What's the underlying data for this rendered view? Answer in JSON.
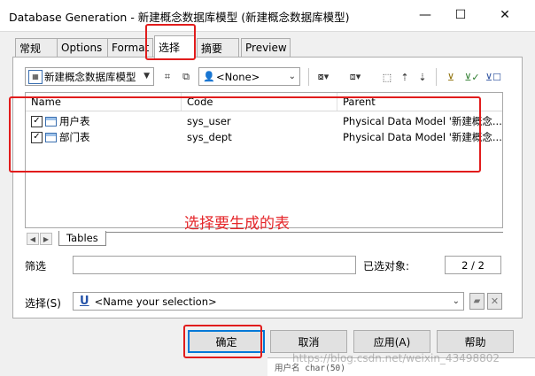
{
  "window": {
    "title": "Database Generation - 新建概念数据库模型 (新建概念数据库模型)",
    "minimize_glyph": "—",
    "maximize_glyph": "☐",
    "close_glyph": "✕"
  },
  "tabs": [
    {
      "label": "常规",
      "active": false
    },
    {
      "label": "Options",
      "active": false
    },
    {
      "label": "Format",
      "active": false
    },
    {
      "label": "选择",
      "active": true
    },
    {
      "label": "摘要",
      "active": false
    },
    {
      "label": "Preview",
      "active": false
    }
  ],
  "toolbar": {
    "model_combo": "新建概念数据库模型",
    "owner_combo": "<None>",
    "icons": [
      "tree-icon",
      "pick-icon",
      "user-icon",
      "select-all-icon",
      "deselect-all-icon",
      "move-up-icon",
      "move-down-icon",
      "filter-icon",
      "filter-selected-icon",
      "filter-clear-icon"
    ]
  },
  "list": {
    "columns": [
      "Name",
      "Code",
      "Parent"
    ],
    "rows": [
      {
        "checked": true,
        "name": "用户表",
        "code": "sys_user",
        "parent": "Physical Data Model '新建概念..."
      },
      {
        "checked": true,
        "name": "部门表",
        "code": "sys_dept",
        "parent": "Physical Data Model '新建概念..."
      }
    ]
  },
  "bottom_tab": "Tables",
  "annotation": "选择要生成的表",
  "filter": {
    "label": "筛选",
    "value": "",
    "selected_label": "已选对象:",
    "selected_count": "2 / 2"
  },
  "selection": {
    "label": "选择(S)",
    "placeholder": "<Name your selection>"
  },
  "buttons": {
    "ok": "确定",
    "cancel": "取消",
    "apply": "应用(A)",
    "help": "帮助"
  },
  "background": {
    "snippet": "用户名  char(50)",
    "watermark": "https://blog.csdn.net/weixin_43498802"
  },
  "colors": {
    "highlight": "#e11c1c",
    "annotation": "#e5262a",
    "default_button_border": "#0078d7"
  }
}
